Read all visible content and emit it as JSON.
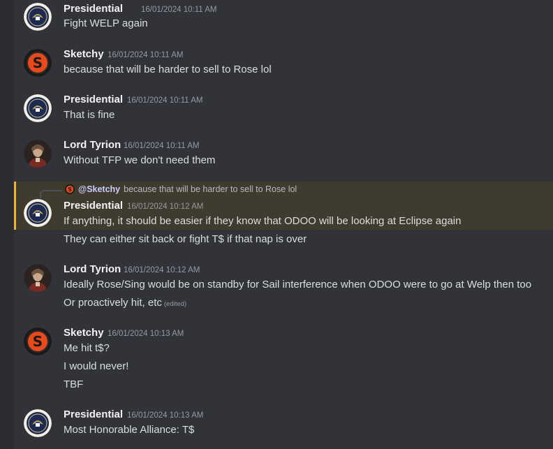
{
  "colors": {
    "background": "#313338",
    "mention_bg": "#3f3b2f",
    "mention_border": "#f0b232",
    "timestamp": "#949ba4"
  },
  "messages": [
    {
      "author": "Presidential",
      "avatar": "presidential-seal-icon",
      "timestamp": "16/01/2024 10:11 AM",
      "lines": [
        "Fight WELP again"
      ]
    },
    {
      "author": "Sketchy",
      "avatar": "sketchy-s-icon",
      "timestamp": "16/01/2024 10:11 AM",
      "lines": [
        "because that will be harder to sell to Rose lol"
      ]
    },
    {
      "author": "Presidential",
      "avatar": "presidential-seal-icon",
      "timestamp": "16/01/2024 10:11 AM",
      "lines": [
        "That is fine"
      ]
    },
    {
      "author": "Lord Tyrion",
      "avatar": "lord-tyrion-portrait-icon",
      "timestamp": "16/01/2024 10:11 AM",
      "lines": [
        "Without TFP we don't need them"
      ]
    },
    {
      "author": "Presidential",
      "avatar": "presidential-seal-icon",
      "timestamp": "16/01/2024 10:12 AM",
      "reply": {
        "user": "@Sketchy",
        "text": "because that will be harder to sell to Rose lol"
      },
      "lines": [
        "If anything, it should be easier if they know that ODOO will be looking at Eclipse again"
      ],
      "followups": [
        "They can either sit back or fight T$ if that nap is over"
      ]
    },
    {
      "author": "Lord Tyrion",
      "avatar": "lord-tyrion-portrait-icon",
      "timestamp": "16/01/2024 10:12 AM",
      "lines": [
        "Ideally Rose/Sing would be on standby for Sail interference when ODOO were to go at Welp then too",
        "Or proactively hit, etc"
      ],
      "edited": "(edited)"
    },
    {
      "author": "Sketchy",
      "avatar": "sketchy-s-icon",
      "timestamp": "16/01/2024 10:13 AM",
      "lines": [
        "Me hit t$?",
        "I would never!",
        "TBF"
      ]
    },
    {
      "author": "Presidential",
      "avatar": "presidential-seal-icon",
      "timestamp": "16/01/2024 10:13 AM",
      "lines": [
        "Most Honorable Alliance: T$"
      ]
    }
  ]
}
